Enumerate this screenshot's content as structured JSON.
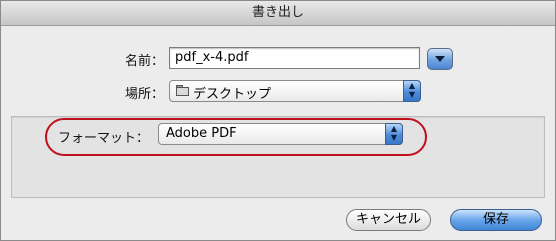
{
  "window": {
    "title": "書き出し"
  },
  "save_as": {
    "label": "名前：",
    "value": "pdf_x-4.pdf"
  },
  "where": {
    "label": "場所：",
    "value": "デスクトップ",
    "icon": "folder-icon"
  },
  "format": {
    "label": "フォーマット：",
    "value": "Adobe PDF",
    "highlight_color": "#c0101c"
  },
  "buttons": {
    "cancel": "キャンセル",
    "save": "保存"
  }
}
